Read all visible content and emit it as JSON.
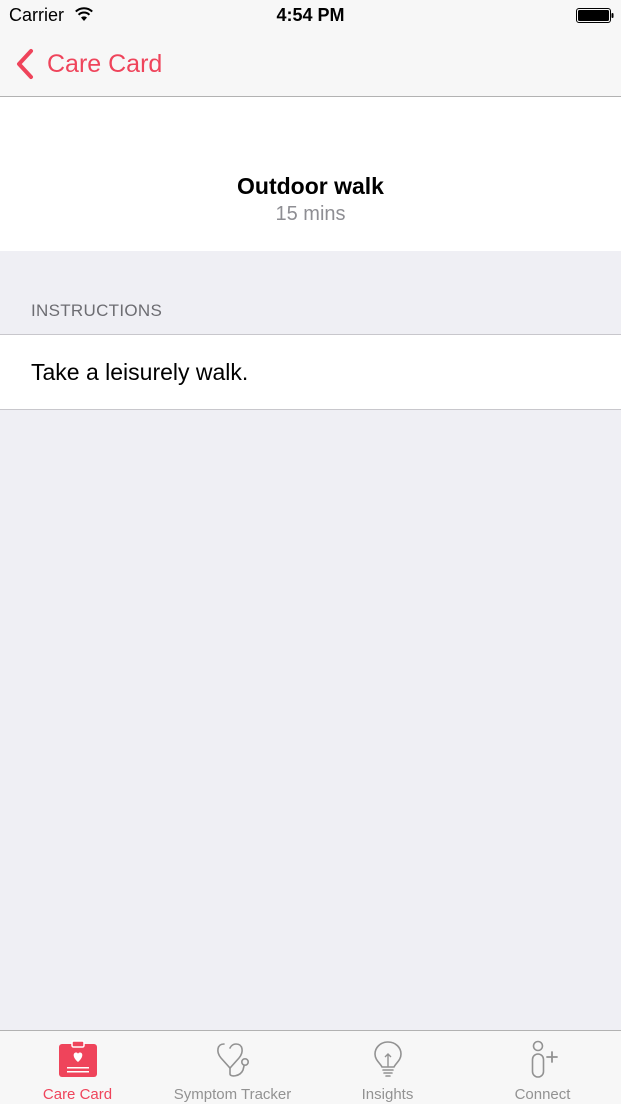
{
  "status_bar": {
    "carrier": "Carrier",
    "time": "4:54 PM",
    "wifi_icon": "wifi-icon",
    "battery_icon": "battery-icon"
  },
  "nav_bar": {
    "back_label": "Care Card",
    "back_icon": "chevron-left-icon"
  },
  "activity": {
    "title": "Outdoor walk",
    "duration": "15 mins"
  },
  "instructions": {
    "header": "INSTRUCTIONS",
    "text": "Take a leisurely walk."
  },
  "tab_bar": {
    "tabs": [
      {
        "label": "Care Card",
        "icon": "care-card-icon",
        "active": true
      },
      {
        "label": "Symptom Tracker",
        "icon": "stethoscope-icon",
        "active": false
      },
      {
        "label": "Insights",
        "icon": "lightbulb-icon",
        "active": false
      },
      {
        "label": "Connect",
        "icon": "add-person-icon",
        "active": false
      }
    ]
  },
  "colors": {
    "accent": "#ef445b",
    "background": "#efeff4",
    "inactive_tab": "#929292",
    "secondary_text": "#8e8e93"
  }
}
